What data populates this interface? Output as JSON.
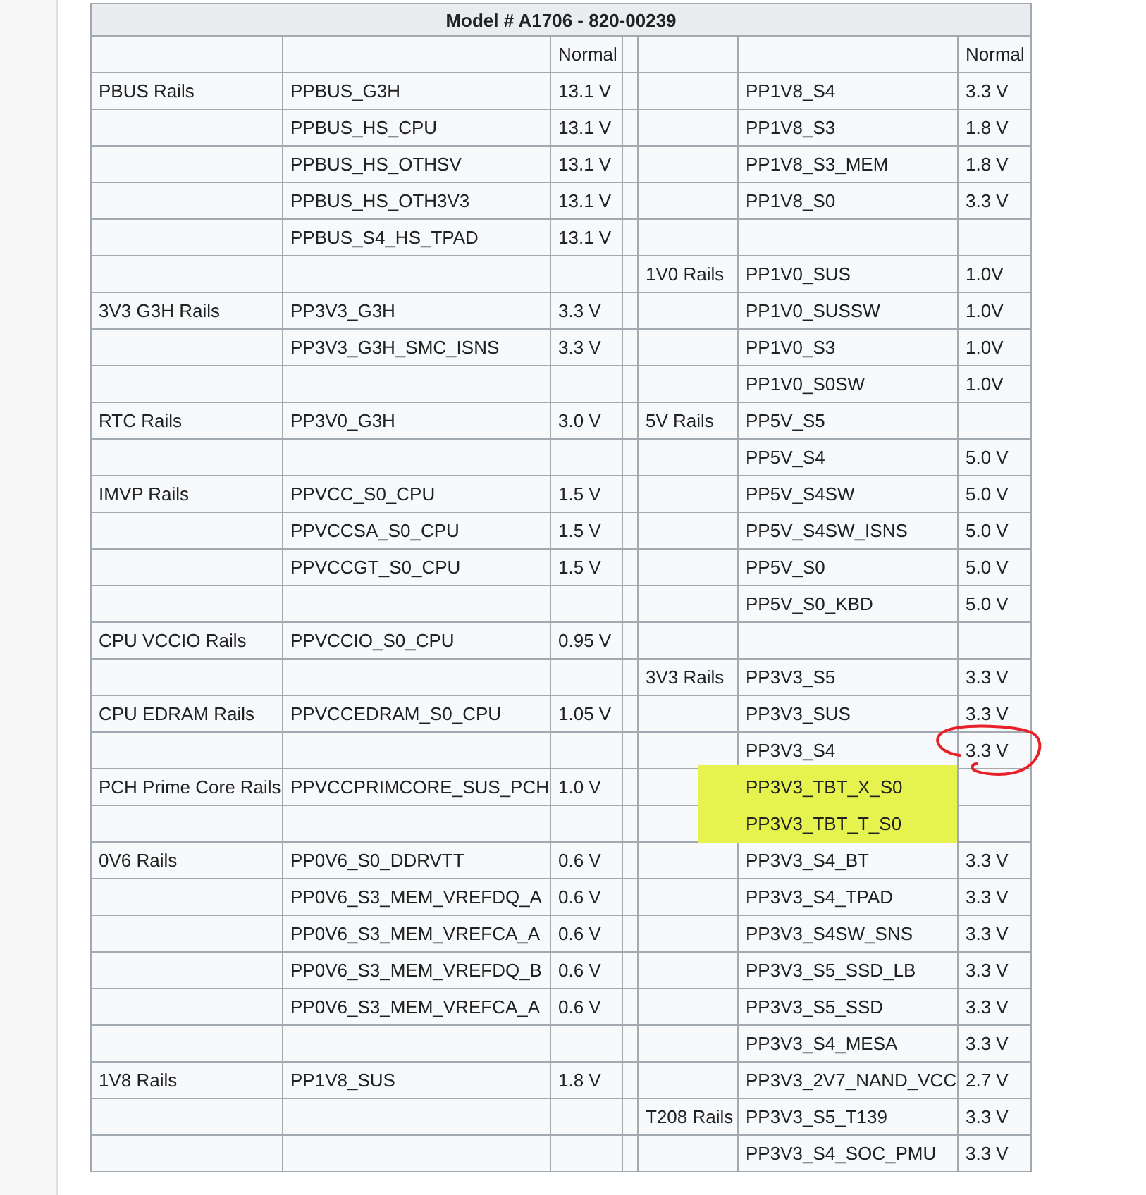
{
  "table": {
    "title": "Model # A1706 - 820-00239",
    "header": {
      "left_voltage": "Normal",
      "right_voltage": "Normal"
    },
    "rows": [
      {
        "left": {
          "group": "PBUS Rails",
          "rail": "PPBUS_G3H",
          "voltage": "13.1 V"
        },
        "right": {
          "rail": "PP1V8_S4",
          "voltage": "3.3 V"
        }
      },
      {
        "left": {
          "rail": "PPBUS_HS_CPU",
          "voltage": "13.1 V"
        },
        "right": {
          "rail": "PP1V8_S3",
          "voltage": "1.8 V"
        }
      },
      {
        "left": {
          "rail": "PPBUS_HS_OTHSV",
          "voltage": "13.1 V"
        },
        "right": {
          "rail": "PP1V8_S3_MEM",
          "voltage": "1.8 V"
        }
      },
      {
        "left": {
          "rail": "PPBUS_HS_OTH3V3",
          "voltage": "13.1 V"
        },
        "right": {
          "rail": "PP1V8_S0",
          "voltage": "3.3 V"
        }
      },
      {
        "left": {
          "rail": "PPBUS_S4_HS_TPAD",
          "voltage": "13.1 V"
        }
      },
      {
        "right": {
          "group": "1V0 Rails",
          "rail": "PP1V0_SUS",
          "voltage": "1.0V"
        }
      },
      {
        "left": {
          "group": "3V3 G3H Rails",
          "rail": "PP3V3_G3H",
          "voltage": "3.3 V"
        },
        "right": {
          "rail": "PP1V0_SUSSW",
          "voltage": "1.0V"
        }
      },
      {
        "left": {
          "rail": "PP3V3_G3H_SMC_ISNS",
          "voltage": "3.3 V"
        },
        "right": {
          "rail": "PP1V0_S3",
          "voltage": "1.0V"
        }
      },
      {
        "right": {
          "rail": "PP1V0_S0SW",
          "voltage": "1.0V"
        }
      },
      {
        "left": {
          "group": "RTC Rails",
          "rail": "PP3V0_G3H",
          "voltage": "3.0 V"
        },
        "right": {
          "group": "5V Rails",
          "rail": "PP5V_S5"
        }
      },
      {
        "right": {
          "rail": "PP5V_S4",
          "voltage": "5.0 V"
        }
      },
      {
        "left": {
          "group": "IMVP Rails",
          "rail": "PPVCC_S0_CPU",
          "voltage": "1.5 V"
        },
        "right": {
          "rail": "PP5V_S4SW",
          "voltage": "5.0 V"
        }
      },
      {
        "left": {
          "rail": "PPVCCSA_S0_CPU",
          "voltage": "1.5 V"
        },
        "right": {
          "rail": "PP5V_S4SW_ISNS",
          "voltage": "5.0 V"
        }
      },
      {
        "left": {
          "rail": "PPVCCGT_S0_CPU",
          "voltage": "1.5 V"
        },
        "right": {
          "rail": "PP5V_S0",
          "voltage": "5.0 V"
        }
      },
      {
        "right": {
          "rail": "PP5V_S0_KBD",
          "voltage": "5.0 V"
        }
      },
      {
        "left": {
          "group": "CPU VCCIO Rails",
          "rail": "PPVCCIO_S0_CPU",
          "voltage": "0.95 V"
        }
      },
      {
        "right": {
          "group": "3V3 Rails",
          "rail": "PP3V3_S5",
          "voltage": "3.3 V"
        }
      },
      {
        "left": {
          "group": "CPU EDRAM Rails",
          "rail": "PPVCCEDRAM_S0_CPU",
          "voltage": "1.05 V"
        },
        "right": {
          "rail": "PP3V3_SUS",
          "voltage": "3.3 V"
        }
      },
      {
        "right": {
          "rail": "PP3V3_S4",
          "voltage": "3.3 V",
          "circled": true
        }
      },
      {
        "left": {
          "group": "PCH Prime Core Rails",
          "rail": "PPVCCPRIMCORE_SUS_PCH",
          "voltage": "1.0 V"
        },
        "right": {
          "rail": "PP3V3_TBT_X_S0",
          "highlighted": true
        }
      },
      {
        "right": {
          "rail": "PP3V3_TBT_T_S0",
          "highlighted": true
        }
      },
      {
        "left": {
          "group": "0V6 Rails",
          "rail": "PP0V6_S0_DDRVTT",
          "voltage": "0.6 V"
        },
        "right": {
          "rail": "PP3V3_S4_BT",
          "voltage": "3.3 V"
        }
      },
      {
        "left": {
          "rail": "PP0V6_S3_MEM_VREFDQ_A",
          "voltage": "0.6 V"
        },
        "right": {
          "rail": "PP3V3_S4_TPAD",
          "voltage": "3.3 V"
        }
      },
      {
        "left": {
          "rail": "PP0V6_S3_MEM_VREFCA_A",
          "voltage": "0.6 V"
        },
        "right": {
          "rail": "PP3V3_S4SW_SNS",
          "voltage": "3.3 V"
        }
      },
      {
        "left": {
          "rail": "PP0V6_S3_MEM_VREFDQ_B",
          "voltage": "0.6 V"
        },
        "right": {
          "rail": "PP3V3_S5_SSD_LB",
          "voltage": "3.3 V"
        }
      },
      {
        "left": {
          "rail": "PP0V6_S3_MEM_VREFCA_A",
          "voltage": "0.6 V"
        },
        "right": {
          "rail": "PP3V3_S5_SSD",
          "voltage": "3.3 V"
        }
      },
      {
        "right": {
          "rail": "PP3V3_S4_MESA",
          "voltage": "3.3 V"
        }
      },
      {
        "left": {
          "group": "1V8 Rails",
          "rail": "PP1V8_SUS",
          "voltage": "1.8 V"
        },
        "right": {
          "rail": "PP3V3_2V7_NAND_VCC",
          "voltage": "2.7 V"
        }
      },
      {
        "right": {
          "group": "T208 Rails",
          "rail": "PP3V3_S5_T139",
          "voltage": "3.3 V"
        }
      },
      {
        "right": {
          "rail": "PP3V3_S4_SOC_PMU",
          "voltage": "3.3 V"
        }
      }
    ]
  }
}
